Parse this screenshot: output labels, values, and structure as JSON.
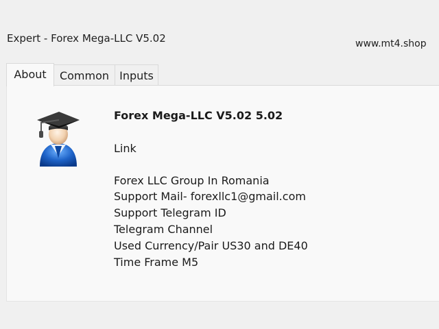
{
  "window": {
    "title": "Expert - Forex Mega-LLC V5.02",
    "watermark": "www.mt4.shop"
  },
  "tabs": [
    {
      "label": "About",
      "active": true
    },
    {
      "label": "Common",
      "active": false
    },
    {
      "label": "Inputs",
      "active": false
    }
  ],
  "about": {
    "icon": "expert-advisor-graduate-icon",
    "heading": "Forex Mega-LLC V5.02 5.02",
    "link": "Link",
    "lines": [
      "Forex LLC Group In Romania",
      "Support Mail- forexllc1@gmail.com",
      "Support Telegram ID",
      "Telegram Channel",
      "Used Currency/Pair US30 and DE40",
      "Time Frame M5"
    ]
  },
  "colors": {
    "background": "#f0f0f0",
    "panel": "#f9f9f9",
    "tab_border": "#d9d9d9",
    "icon_blue": "#1e63c8"
  }
}
